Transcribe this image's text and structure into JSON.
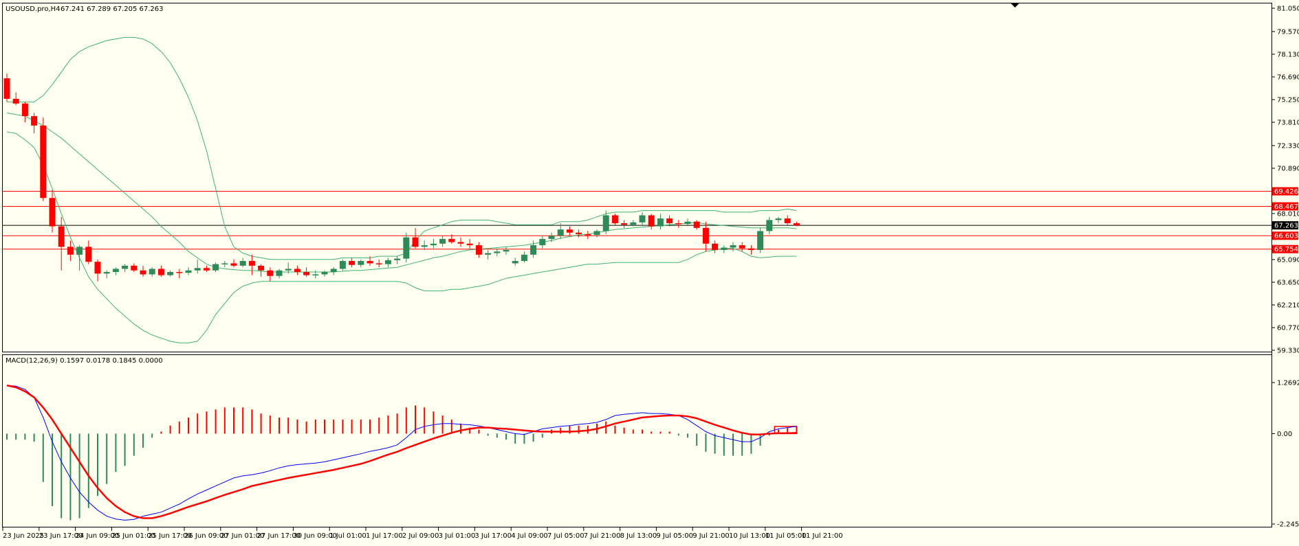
{
  "header": {
    "symbol": "USOUSD.pro,H4",
    "ohlc": "67.241 67.289 67.205 67.263"
  },
  "macd_header": {
    "label": "MACD(12,26,9) 0.1597 0.0178 0.1845 0.0000"
  },
  "colors": {
    "background": "#FFFFF0",
    "bull": "#2E8B57",
    "bear": "#FF0000",
    "bands": "#3CB371",
    "macd_line": "#0000FF",
    "signal_line": "#FF0000",
    "level": "#FF0000",
    "current_price": "#000000"
  },
  "chart_data": [
    {
      "type": "candlestick",
      "title": "",
      "price_axis": {
        "ylim": [
          59.33,
          81.05
        ],
        "ticks": [
          "81.050",
          "79.570",
          "78.130",
          "76.690",
          "75.250",
          "73.810",
          "72.330",
          "70.890",
          "69.426",
          "68.467",
          "68.010",
          "67.263",
          "66.603",
          "65.754",
          "65.090",
          "63.650",
          "62.210",
          "60.770",
          "59.330"
        ]
      },
      "time_axis": {
        "labels": [
          "23 Jun 2025",
          "23 Jun 17:00",
          "24 Jun 09:00",
          "25 Jun 01:00",
          "25 Jun 17:00",
          "26 Jun 09:00",
          "27 Jun 01:00",
          "27 Jun 17:00",
          "30 Jun 09:00",
          "1 Jul 01:00",
          "1 Jul 17:00",
          "2 Jul 09:00",
          "3 Jul 01:00",
          "3 Jul 17:00",
          "4 Jul 09:00",
          "7 Jul 05:00",
          "7 Jul 21:00",
          "8 Jul 13:00",
          "9 Jul 05:00",
          "9 Jul 21:00",
          "10 Jul 13:00",
          "11 Jul 05:00",
          "11 Jul 21:00"
        ],
        "label_bar_index": [
          0,
          4,
          8,
          12,
          16,
          20,
          24,
          28,
          32,
          36,
          40,
          44,
          48,
          52,
          56,
          60,
          64,
          68,
          72,
          76,
          80,
          84,
          88
        ]
      },
      "levels": [
        {
          "price": 69.426,
          "label": "69.426"
        },
        {
          "price": 68.467,
          "label": "68.467"
        },
        {
          "price": 66.603,
          "label": "66.603"
        },
        {
          "price": 65.754,
          "label": "65.754"
        }
      ],
      "current_price": {
        "price": 67.263,
        "label": "67.263"
      },
      "candles": [
        [
          76.6,
          76.9,
          75.1,
          75.3
        ],
        [
          75.3,
          75.7,
          74.9,
          75.0
        ],
        [
          75.0,
          75.1,
          73.8,
          74.2
        ],
        [
          74.2,
          74.4,
          73.1,
          73.6
        ],
        [
          73.6,
          74.1,
          68.8,
          69.0
        ],
        [
          69.0,
          69.5,
          66.8,
          67.2
        ],
        [
          67.2,
          67.8,
          64.4,
          65.9
        ],
        [
          65.9,
          66.3,
          65.0,
          65.4
        ],
        [
          65.4,
          66.0,
          64.4,
          65.9
        ],
        [
          65.9,
          66.3,
          64.8,
          64.95
        ],
        [
          64.95,
          65.1,
          63.7,
          64.2
        ],
        [
          64.2,
          64.4,
          63.9,
          64.3
        ],
        [
          64.3,
          64.6,
          64.1,
          64.5
        ],
        [
          64.5,
          64.8,
          64.3,
          64.7
        ],
        [
          64.7,
          64.85,
          64.3,
          64.4
        ],
        [
          64.4,
          64.7,
          64.0,
          64.15
        ],
        [
          64.15,
          64.6,
          64.0,
          64.5
        ],
        [
          64.5,
          64.7,
          64.0,
          64.1
        ],
        [
          64.1,
          64.4,
          64.0,
          64.3
        ],
        [
          64.3,
          64.5,
          63.9,
          64.25
        ],
        [
          64.25,
          64.6,
          64.1,
          64.4
        ],
        [
          64.4,
          65.1,
          64.2,
          64.55
        ],
        [
          64.55,
          64.7,
          64.3,
          64.4
        ],
        [
          64.4,
          64.9,
          64.3,
          64.8
        ],
        [
          64.8,
          65.0,
          64.6,
          64.85
        ],
        [
          64.85,
          65.1,
          64.6,
          64.7
        ],
        [
          64.7,
          65.2,
          64.6,
          65.0
        ],
        [
          65.0,
          65.4,
          64.1,
          64.7
        ],
        [
          64.7,
          64.8,
          64.0,
          64.4
        ],
        [
          64.4,
          64.6,
          63.7,
          64.05
        ],
        [
          64.05,
          64.5,
          63.9,
          64.4
        ],
        [
          64.4,
          64.9,
          64.2,
          64.5
        ],
        [
          64.5,
          64.7,
          64.1,
          64.3
        ],
        [
          64.3,
          64.6,
          64.0,
          64.1
        ],
        [
          64.1,
          64.4,
          63.9,
          64.15
        ],
        [
          64.15,
          64.4,
          64.0,
          64.3
        ],
        [
          64.3,
          64.6,
          64.1,
          64.5
        ],
        [
          64.5,
          65.1,
          64.4,
          65.0
        ],
        [
          65.0,
          65.2,
          64.6,
          64.75
        ],
        [
          64.75,
          65.1,
          64.6,
          65.0
        ],
        [
          65.0,
          65.3,
          64.7,
          64.85
        ],
        [
          64.85,
          65.1,
          64.6,
          64.8
        ],
        [
          64.8,
          65.2,
          64.6,
          65.05
        ],
        [
          65.05,
          65.3,
          64.8,
          65.15
        ],
        [
          65.15,
          66.8,
          64.9,
          66.5
        ],
        [
          66.5,
          67.1,
          65.8,
          65.9
        ],
        [
          65.9,
          66.3,
          65.7,
          66.0
        ],
        [
          66.0,
          66.4,
          65.8,
          66.1
        ],
        [
          66.1,
          66.6,
          65.9,
          66.4
        ],
        [
          66.4,
          66.7,
          66.1,
          66.2
        ],
        [
          66.2,
          66.5,
          65.9,
          66.1
        ],
        [
          66.1,
          66.4,
          65.8,
          66.0
        ],
        [
          66.0,
          66.2,
          65.2,
          65.4
        ],
        [
          65.4,
          65.7,
          65.1,
          65.5
        ],
        [
          65.5,
          65.8,
          65.3,
          65.6
        ],
        [
          65.6,
          65.9,
          65.4,
          65.7
        ],
        [
          64.85,
          65.2,
          64.7,
          65.0
        ],
        [
          65.0,
          65.6,
          64.9,
          65.4
        ],
        [
          65.4,
          66.3,
          65.2,
          66.0
        ],
        [
          66.0,
          66.6,
          65.8,
          66.4
        ],
        [
          66.4,
          66.8,
          66.2,
          66.6
        ],
        [
          66.6,
          67.4,
          66.4,
          67.0
        ],
        [
          67.0,
          67.2,
          66.6,
          66.8
        ],
        [
          66.8,
          67.0,
          66.5,
          66.7
        ],
        [
          66.7,
          66.9,
          66.4,
          66.65
        ],
        [
          66.65,
          67.0,
          66.5,
          66.9
        ],
        [
          66.9,
          68.2,
          66.7,
          67.9
        ],
        [
          67.9,
          68.0,
          67.3,
          67.4
        ],
        [
          67.4,
          67.6,
          67.1,
          67.3
        ],
        [
          67.3,
          67.6,
          67.2,
          67.45
        ],
        [
          67.45,
          68.1,
          67.3,
          67.9
        ],
        [
          67.9,
          68.0,
          67.0,
          67.2
        ],
        [
          67.2,
          68.0,
          67.0,
          67.7
        ],
        [
          67.7,
          67.9,
          67.2,
          67.4
        ],
        [
          67.4,
          67.6,
          67.1,
          67.35
        ],
        [
          67.35,
          67.7,
          67.2,
          67.5
        ],
        [
          67.5,
          67.6,
          67.0,
          67.1
        ],
        [
          67.1,
          67.5,
          65.6,
          66.1
        ],
        [
          66.1,
          66.3,
          65.5,
          65.7
        ],
        [
          65.7,
          66.0,
          65.5,
          65.85
        ],
        [
          65.85,
          66.2,
          65.6,
          66.0
        ],
        [
          66.0,
          66.2,
          65.6,
          65.8
        ],
        [
          65.8,
          66.0,
          65.4,
          65.7
        ],
        [
          65.7,
          67.1,
          65.5,
          66.9
        ],
        [
          66.9,
          67.8,
          66.7,
          67.6
        ],
        [
          67.6,
          67.8,
          67.4,
          67.7
        ],
        [
          67.7,
          67.9,
          67.3,
          67.4
        ],
        [
          67.4,
          67.5,
          67.2,
          67.263
        ]
      ],
      "bollinger": {
        "upper": [
          75.1,
          75.1,
          75.1,
          75.1,
          75.5,
          76.2,
          77.0,
          77.8,
          78.3,
          78.6,
          78.8,
          79.0,
          79.1,
          79.2,
          79.2,
          79.1,
          78.8,
          78.3,
          77.6,
          76.6,
          75.4,
          73.9,
          72.0,
          69.6,
          67.2,
          65.9,
          65.5,
          65.3,
          65.2,
          65.1,
          65.1,
          65.1,
          65.1,
          65.1,
          65.1,
          65.1,
          65.1,
          65.2,
          65.2,
          65.2,
          65.2,
          65.3,
          65.3,
          65.3,
          65.5,
          66.3,
          66.9,
          67.1,
          67.3,
          67.5,
          67.6,
          67.6,
          67.6,
          67.6,
          67.5,
          67.4,
          67.3,
          67.3,
          67.3,
          67.3,
          67.3,
          67.5,
          67.5,
          67.5,
          67.6,
          67.8,
          68.0,
          68.1,
          68.1,
          68.1,
          68.2,
          68.2,
          68.2,
          68.2,
          68.2,
          68.2,
          68.2,
          68.2,
          68.2,
          68.1,
          68.1,
          68.1,
          68.1,
          68.2,
          68.2,
          68.2,
          68.3,
          68.2
        ],
        "middle": [
          74.4,
          74.3,
          74.2,
          73.9,
          73.6,
          73.2,
          72.8,
          72.3,
          71.8,
          71.3,
          70.8,
          70.3,
          69.8,
          69.3,
          68.8,
          68.3,
          67.8,
          67.2,
          66.7,
          66.2,
          65.6,
          65.2,
          64.8,
          64.6,
          64.5,
          64.45,
          64.4,
          64.4,
          64.35,
          64.3,
          64.3,
          64.3,
          64.3,
          64.3,
          64.3,
          64.3,
          64.3,
          64.35,
          64.4,
          64.4,
          64.45,
          64.5,
          64.55,
          64.6,
          64.75,
          64.9,
          65.05,
          65.2,
          65.3,
          65.45,
          65.6,
          65.7,
          65.75,
          65.8,
          65.85,
          65.9,
          65.95,
          66.0,
          66.1,
          66.2,
          66.3,
          66.45,
          66.55,
          66.65,
          66.7,
          66.8,
          66.9,
          67.0,
          67.05,
          67.1,
          67.15,
          67.2,
          67.25,
          67.3,
          67.35,
          67.4,
          67.45,
          67.35,
          67.3,
          67.25,
          67.2,
          67.15,
          67.1,
          67.1,
          67.1,
          67.1,
          67.1,
          67.05
        ],
        "lower": [
          73.2,
          73.1,
          72.7,
          72.2,
          71.1,
          69.6,
          68.0,
          66.5,
          65.2,
          64.0,
          63.2,
          62.6,
          62.0,
          61.5,
          61.0,
          60.6,
          60.3,
          60.1,
          59.9,
          59.8,
          59.8,
          59.9,
          60.6,
          61.6,
          62.3,
          63.0,
          63.4,
          63.6,
          63.7,
          63.7,
          63.7,
          63.7,
          63.7,
          63.7,
          63.7,
          63.7,
          63.7,
          63.7,
          63.7,
          63.7,
          63.7,
          63.7,
          63.7,
          63.7,
          63.6,
          63.3,
          63.1,
          63.1,
          63.1,
          63.2,
          63.2,
          63.3,
          63.4,
          63.5,
          63.7,
          63.9,
          64.0,
          64.1,
          64.2,
          64.3,
          64.4,
          64.5,
          64.6,
          64.7,
          64.8,
          64.8,
          64.85,
          64.9,
          64.9,
          64.9,
          64.9,
          64.9,
          64.9,
          64.9,
          64.9,
          65.1,
          65.4,
          65.6,
          65.7,
          65.8,
          65.8,
          65.6,
          65.3,
          65.2,
          65.25,
          65.3,
          65.3,
          65.3
        ]
      }
    },
    {
      "type": "bar+line",
      "title": "",
      "ylim": [
        -2.2453,
        1.2692
      ],
      "ticks": [
        "1.2692",
        "0.00",
        "-2.2453"
      ],
      "histogram": [
        -0.15,
        -0.15,
        -0.15,
        -0.2,
        -1.2,
        -1.8,
        -2.1,
        -2.15,
        -2.1,
        -1.85,
        -1.55,
        -1.25,
        -0.95,
        -0.8,
        -0.55,
        -0.35,
        -0.1,
        0.05,
        0.2,
        0.3,
        0.4,
        0.5,
        0.55,
        0.6,
        0.65,
        0.65,
        0.65,
        0.6,
        0.5,
        0.45,
        0.4,
        0.4,
        0.35,
        0.3,
        0.35,
        0.35,
        0.35,
        0.35,
        0.35,
        0.35,
        0.35,
        0.4,
        0.45,
        0.5,
        0.65,
        0.7,
        0.65,
        0.55,
        0.45,
        0.35,
        0.25,
        0.15,
        0.1,
        -0.05,
        -0.1,
        -0.15,
        -0.25,
        -0.25,
        -0.2,
        -0.1,
        0.1,
        0.15,
        0.2,
        0.2,
        0.2,
        0.25,
        0.3,
        0.2,
        0.15,
        0.1,
        0.1,
        0.05,
        0.05,
        0.05,
        -0.05,
        -0.1,
        -0.3,
        -0.45,
        -0.5,
        -0.55,
        -0.55,
        -0.55,
        -0.5,
        -0.3,
        -0.05,
        0.1,
        0.15,
        0.18
      ],
      "macd": [
        1.2,
        1.18,
        1.1,
        0.9,
        0.4,
        -0.2,
        -0.7,
        -1.1,
        -1.45,
        -1.7,
        -1.9,
        -2.05,
        -2.12,
        -2.15,
        -2.13,
        -2.05,
        -2.0,
        -1.95,
        -1.85,
        -1.75,
        -1.62,
        -1.5,
        -1.4,
        -1.3,
        -1.2,
        -1.1,
        -1.05,
        -1.02,
        -0.98,
        -0.92,
        -0.85,
        -0.8,
        -0.77,
        -0.75,
        -0.73,
        -0.7,
        -0.65,
        -0.6,
        -0.55,
        -0.5,
        -0.44,
        -0.4,
        -0.35,
        -0.28,
        -0.1,
        0.1,
        0.18,
        0.22,
        0.25,
        0.25,
        0.23,
        0.22,
        0.19,
        0.15,
        0.1,
        0.05,
        0.0,
        -0.02,
        0.05,
        0.12,
        0.15,
        0.18,
        0.2,
        0.23,
        0.25,
        0.28,
        0.35,
        0.45,
        0.48,
        0.5,
        0.52,
        0.5,
        0.5,
        0.48,
        0.45,
        0.35,
        0.2,
        0.05,
        -0.05,
        -0.1,
        -0.15,
        -0.2,
        -0.2,
        -0.1,
        0.05,
        0.12,
        0.15,
        0.18
      ],
      "signal": [
        1.2,
        1.15,
        1.05,
        0.9,
        0.65,
        0.35,
        0.0,
        -0.35,
        -0.7,
        -1.05,
        -1.35,
        -1.6,
        -1.8,
        -1.95,
        -2.05,
        -2.1,
        -2.1,
        -2.05,
        -1.98,
        -1.9,
        -1.82,
        -1.75,
        -1.68,
        -1.6,
        -1.52,
        -1.45,
        -1.38,
        -1.3,
        -1.25,
        -1.2,
        -1.15,
        -1.1,
        -1.06,
        -1.02,
        -0.98,
        -0.94,
        -0.9,
        -0.85,
        -0.8,
        -0.75,
        -0.68,
        -0.6,
        -0.52,
        -0.45,
        -0.36,
        -0.28,
        -0.2,
        -0.12,
        -0.05,
        0.02,
        0.08,
        0.12,
        0.15,
        0.15,
        0.13,
        0.12,
        0.1,
        0.08,
        0.06,
        0.05,
        0.05,
        0.05,
        0.05,
        0.06,
        0.08,
        0.12,
        0.18,
        0.25,
        0.3,
        0.35,
        0.4,
        0.42,
        0.44,
        0.45,
        0.45,
        0.43,
        0.38,
        0.3,
        0.22,
        0.15,
        0.08,
        0.02,
        -0.02,
        -0.02,
        0.0,
        0.01,
        0.01,
        0.02
      ]
    }
  ]
}
